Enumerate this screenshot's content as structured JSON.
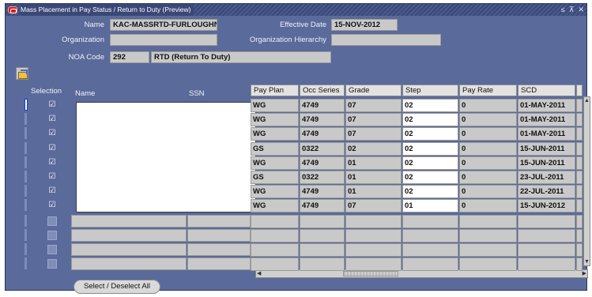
{
  "window": {
    "title": "Mass Placement in Pay Status / Return to Duty (Preview)",
    "controls": [
      "≤",
      "⊼",
      "✕"
    ]
  },
  "header": {
    "name_label": "Name",
    "name_value": "KAC-MASSRTD-FURLOUGHN",
    "effective_date_label": "Effective Date",
    "effective_date_value": "15-NOV-2012",
    "organization_label": "Organization",
    "organization_value": "",
    "org_hierarchy_label": "Organization Hierarchy",
    "org_hierarchy_value": "",
    "noa_code_label": "NOA Code",
    "noa_code_value": "292",
    "noa_desc_value": "RTD (Return To Duty)"
  },
  "table": {
    "headers": {
      "selection": "Selection",
      "name": "Name",
      "ssn": "SSN",
      "pay_plan": "Pay Plan",
      "occ_series": "Occ Series",
      "grade": "Grade",
      "step": "Step",
      "pay_rate": "Pay Rate",
      "scd": "SCD"
    },
    "rows": [
      {
        "checked": true,
        "pay_plan": "WG",
        "occ_series": "4749",
        "grade": "07",
        "step": "02",
        "pay_rate": "0",
        "scd": "01-MAY-2011"
      },
      {
        "checked": true,
        "pay_plan": "WG",
        "occ_series": "4749",
        "grade": "07",
        "step": "02",
        "pay_rate": "0",
        "scd": "01-MAY-2011"
      },
      {
        "checked": true,
        "pay_plan": "WG",
        "occ_series": "4749",
        "grade": "07",
        "step": "02",
        "pay_rate": "0",
        "scd": "01-MAY-2011"
      },
      {
        "checked": true,
        "pay_plan": "GS",
        "occ_series": "0322",
        "grade": "02",
        "step": "02",
        "pay_rate": "0",
        "scd": "15-JUN-2011"
      },
      {
        "checked": true,
        "pay_plan": "WG",
        "occ_series": "4749",
        "grade": "01",
        "step": "02",
        "pay_rate": "0",
        "scd": "15-JUN-2011"
      },
      {
        "checked": true,
        "pay_plan": "GS",
        "occ_series": "0322",
        "grade": "01",
        "step": "02",
        "pay_rate": "0",
        "scd": "23-JUL-2011"
      },
      {
        "checked": true,
        "pay_plan": "WG",
        "occ_series": "4749",
        "grade": "01",
        "step": "02",
        "pay_rate": "0",
        "scd": "22-JUL-2011"
      },
      {
        "checked": true,
        "pay_plan": "WG",
        "occ_series": "4749",
        "grade": "07",
        "step": "01",
        "pay_rate": "0",
        "scd": "15-JUN-2012"
      }
    ],
    "empty_rows": 4
  },
  "footer": {
    "select_all_label": "Select / Deselect  All"
  },
  "colors": {
    "window_bg": "#5a6a9a",
    "field_bg": "#c9c9c9",
    "title_accent": "#d21f1f"
  }
}
